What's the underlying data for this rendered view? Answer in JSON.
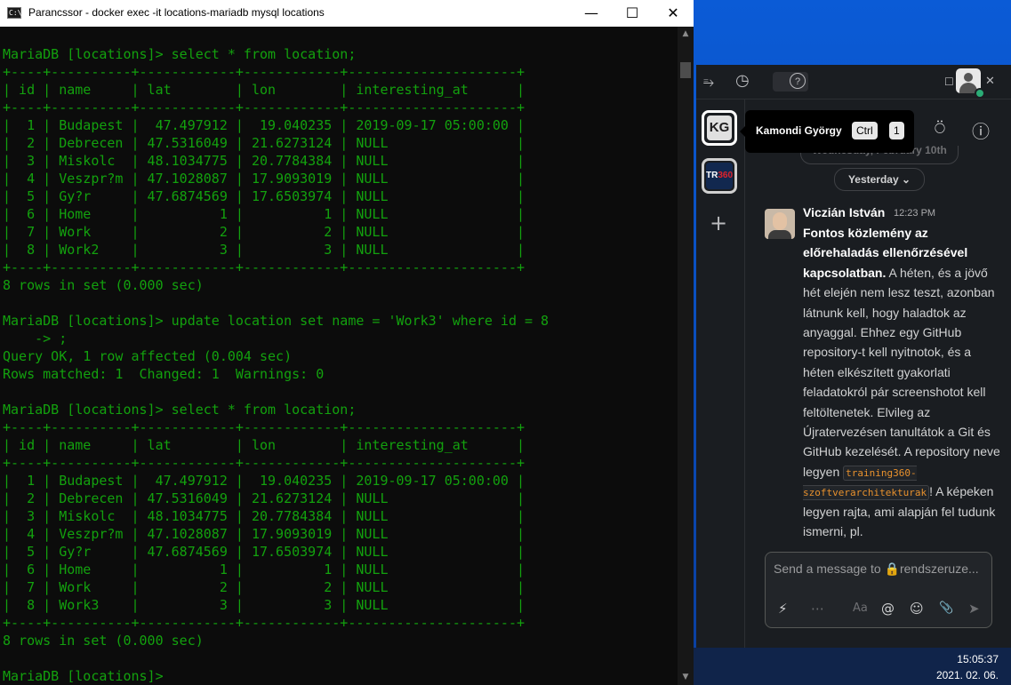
{
  "console": {
    "title": "Parancssor - docker  exec -it locations-mariadb mysql locations",
    "icon": "console-app-icon",
    "controls": {
      "minimize": "—",
      "maximize": "☐",
      "close": "✕"
    },
    "lines": [
      "MariaDB [locations]> select * from location;",
      "+----+----------+------------+------------+---------------------+",
      "| id | name     | lat        | lon        | interesting_at      |",
      "+----+----------+------------+------------+---------------------+",
      "|  1 | Budapest |  47.497912 |  19.040235 | 2019-09-17 05:00:00 |",
      "|  2 | Debrecen | 47.5316049 | 21.6273124 | NULL                |",
      "|  3 | Miskolc  | 48.1034775 | 20.7784384 | NULL                |",
      "|  4 | Veszpr?m | 47.1028087 | 17.9093019 | NULL                |",
      "|  5 | Gy?r     | 47.6874569 | 17.6503974 | NULL                |",
      "|  6 | Home     |          1 |          1 | NULL                |",
      "|  7 | Work     |          2 |          2 | NULL                |",
      "|  8 | Work2    |          3 |          3 | NULL                |",
      "+----+----------+------------+------------+---------------------+",
      "8 rows in set (0.000 sec)",
      "",
      "MariaDB [locations]> update location set name = 'Work3' where id = 8",
      "    -> ;",
      "Query OK, 1 row affected (0.004 sec)",
      "Rows matched: 1  Changed: 1  Warnings: 0",
      "",
      "MariaDB [locations]> select * from location;",
      "+----+----------+------------+------------+---------------------+",
      "| id | name     | lat        | lon        | interesting_at      |",
      "+----+----------+------------+------------+---------------------+",
      "|  1 | Budapest |  47.497912 |  19.040235 | 2019-09-17 05:00:00 |",
      "|  2 | Debrecen | 47.5316049 | 21.6273124 | NULL                |",
      "|  3 | Miskolc  | 48.1034775 | 20.7784384 | NULL                |",
      "|  4 | Veszpr?m | 47.1028087 | 17.9093019 | NULL                |",
      "|  5 | Gy?r     | 47.6874569 | 17.6503974 | NULL                |",
      "|  6 | Home     |          1 |          1 | NULL                |",
      "|  7 | Work     |          2 |          2 | NULL                |",
      "|  8 | Work3    |          3 |          3 | NULL                |",
      "+----+----------+------------+------------+---------------------+",
      "8 rows in set (0.000 sec)",
      "",
      "MariaDB [locations]> "
    ],
    "colors": {
      "background": "#0c0c0c",
      "text": "#13a10e",
      "cursor": "#f2f2f2"
    }
  },
  "slack": {
    "topbar": {
      "sidebar_toggle_icon": "sidebar-toggle-icon",
      "history_icon": "history-icon",
      "help_icon": "?",
      "window_close": "✕",
      "window_restore": "☐"
    },
    "workspaces": [
      {
        "label": "KG",
        "name": "Kamondi György"
      },
      {
        "label_prefix": "TR",
        "label_suffix": "360"
      }
    ],
    "add_workspace": "+",
    "tooltip": {
      "name": "Kamondi György",
      "key1": "Ctrl",
      "key2": "1"
    },
    "header_icons": {
      "add_member": "add-member-icon",
      "info": "ⓘ"
    },
    "day_divider_partial": "Wednesday, February 10th",
    "day_divider": "Yesterday",
    "message": {
      "sender": "Viczián István",
      "time": "12:23 PM",
      "bold": "Fontos közlemény az előrehaladás ellenőrzésével kapcsolatban.",
      "text_1": " A héten, és a jövő hét elején nem lesz teszt, azonban látnunk kell, hogy haladtok az anyaggal. Ehhez egy GitHub repository-t kell nyitnotok, és a héten elkészített gyakorlati feladatokról pár screenshotot kell feltöltenetek. Elvileg az Újratervezésen tanultátok a Git és GitHub kezelését. A repository neve legyen ",
      "code": "training360-szoftverarchitekturak",
      "text_2": "! A képeken legyen rajta, ami alapján fel tudunk ismerni, pl."
    },
    "composer": {
      "placeholder": "Send a message to 🔒rendszeruze..."
    },
    "composer_icons": [
      "⚡",
      "⋯",
      "Aa",
      "@",
      "☺",
      "📎",
      "➤"
    ]
  },
  "taskbar": {
    "time": "15:05:37",
    "date": "2021. 02. 06."
  }
}
